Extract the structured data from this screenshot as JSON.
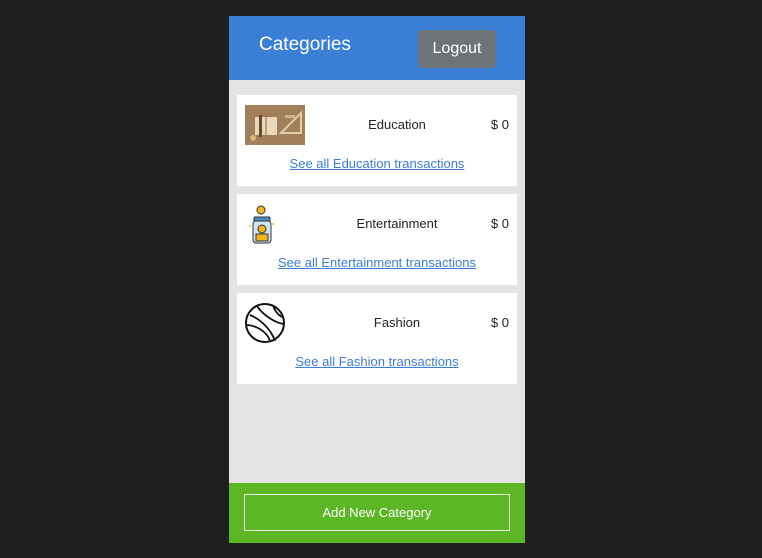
{
  "header": {
    "title": "Categories",
    "logout_label": "Logout"
  },
  "categories": [
    {
      "name": "Education",
      "amount": "$ 0",
      "link": "See all Education transactions",
      "icon": "education-photo-icon"
    },
    {
      "name": "Entertainment",
      "amount": "$ 0",
      "link": "See all Entertainment transactions",
      "icon": "coin-jar-icon"
    },
    {
      "name": "Fashion",
      "amount": "$ 0",
      "link": "See all Fashion transactions",
      "icon": "basketball-icon"
    }
  ],
  "footer": {
    "add_label": "Add New Category"
  },
  "colors": {
    "header": "#3a7fd5",
    "footer": "#5db625",
    "link": "#3a7fd5",
    "logout_bg": "#6e7378"
  }
}
